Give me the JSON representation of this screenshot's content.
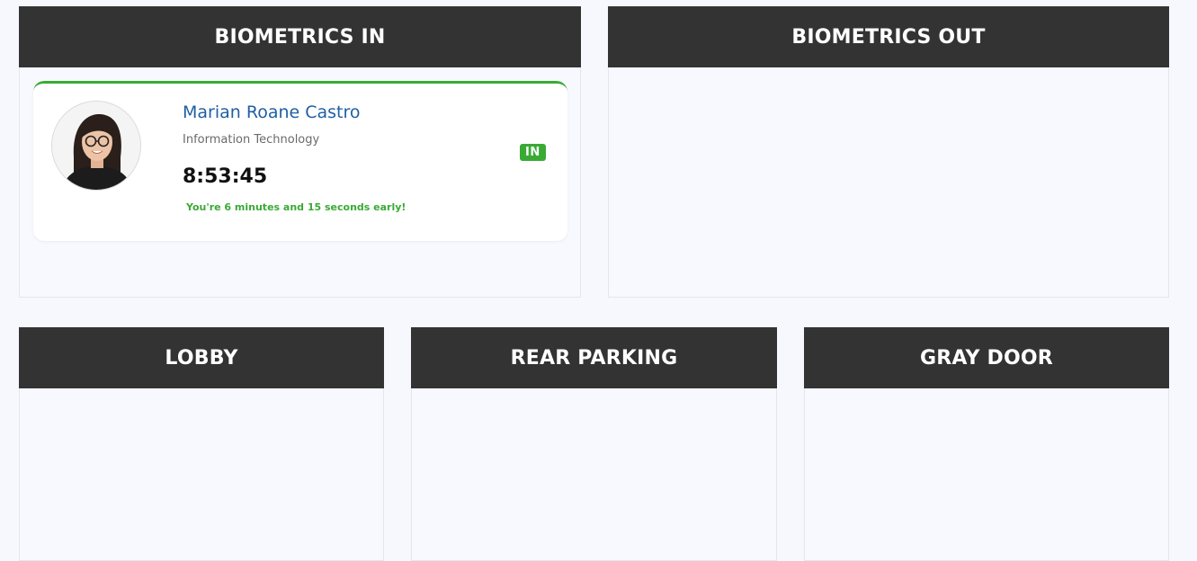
{
  "panels": {
    "biometrics_in": {
      "title": "BIOMETRICS IN"
    },
    "biometrics_out": {
      "title": "BIOMETRICS OUT"
    },
    "lobby": {
      "title": "LOBBY"
    },
    "rear_parking": {
      "title": "REAR PARKING"
    },
    "gray_door": {
      "title": "GRAY DOOR"
    }
  },
  "entry": {
    "name": "Marian Roane Castro",
    "department": "Information Technology",
    "time": "8:53:45",
    "status": "IN",
    "note": "You're 6 minutes and 15 seconds early!"
  },
  "colors": {
    "header_bg": "#333333",
    "accent_green": "#3aaa35",
    "name_blue": "#1f5fa4"
  }
}
